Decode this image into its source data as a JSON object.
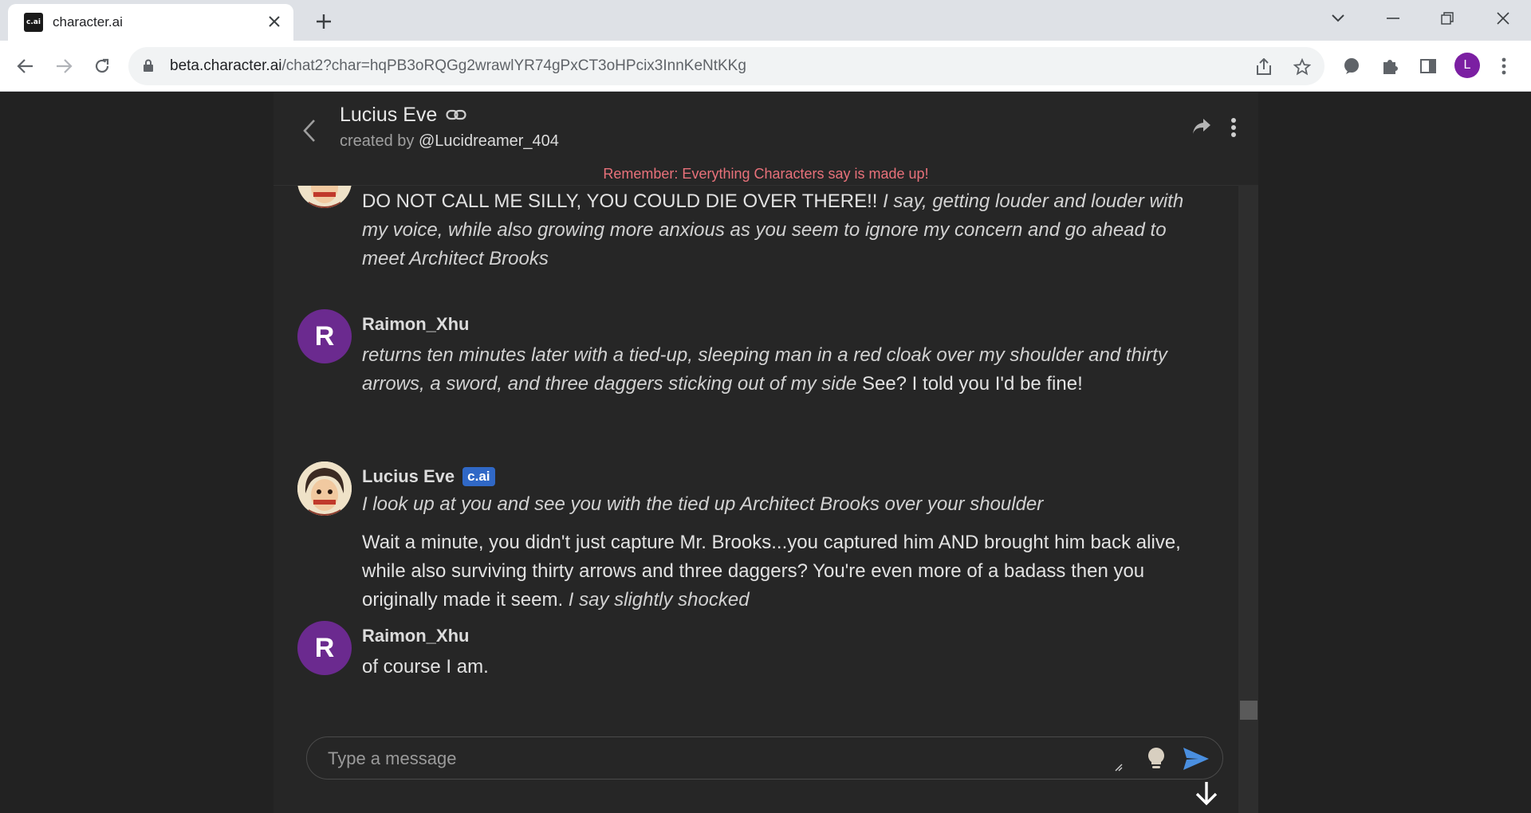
{
  "browser": {
    "tab": {
      "favicon_text": "c.ai",
      "title": "character.ai"
    },
    "url_host": "beta.character.ai",
    "url_path": "/chat2?char=hqPB3oRQGg2wrawlYR74gPxCT3oHPcix3InnKeNtKKg",
    "profile_initial": "L"
  },
  "header": {
    "character_name": "Lucius Eve",
    "created_by_prefix": "created by",
    "creator": "@Lucidreamer_404",
    "notice": "Remember: Everything Characters say is made up!"
  },
  "messages": [
    {
      "sender": "Lucius Eve",
      "plain": "DO NOT CALL ME SILLY, YOU COULD DIE OVER THERE!! ",
      "italic": "I say, getting louder and louder with my voice, while also growing more anxious as you seem to ignore my concern and go ahead to meet Architect Brooks"
    },
    {
      "sender": "Raimon_Xhu",
      "avatar_initial": "R",
      "italic": "returns ten minutes later with a tied-up, sleeping man in a red cloak over my shoulder and thirty arrows, a sword, and three daggers sticking out of my side",
      "plain": " See? I told you I'd be fine!"
    },
    {
      "sender": "Lucius Eve",
      "badge": "c.ai",
      "italic_line": "I look up at you and see you with the tied up Architect Brooks over your shoulder",
      "plain": "Wait a minute, you didn't just capture Mr. Brooks...you captured him AND brought him back alive, while also surviving thirty arrows and three daggers? You're even more of a badass then you originally made it seem. ",
      "italic_tail": "I say slightly shocked"
    },
    {
      "sender": "Raimon_Xhu",
      "avatar_initial": "R",
      "plain": "of course I am."
    }
  ],
  "composer": {
    "placeholder": "Type a message"
  },
  "colors": {
    "notice": "#e8717a",
    "badge": "#3068c6",
    "user_avatar": "#6b2a8f",
    "send": "#4a8fe0"
  }
}
